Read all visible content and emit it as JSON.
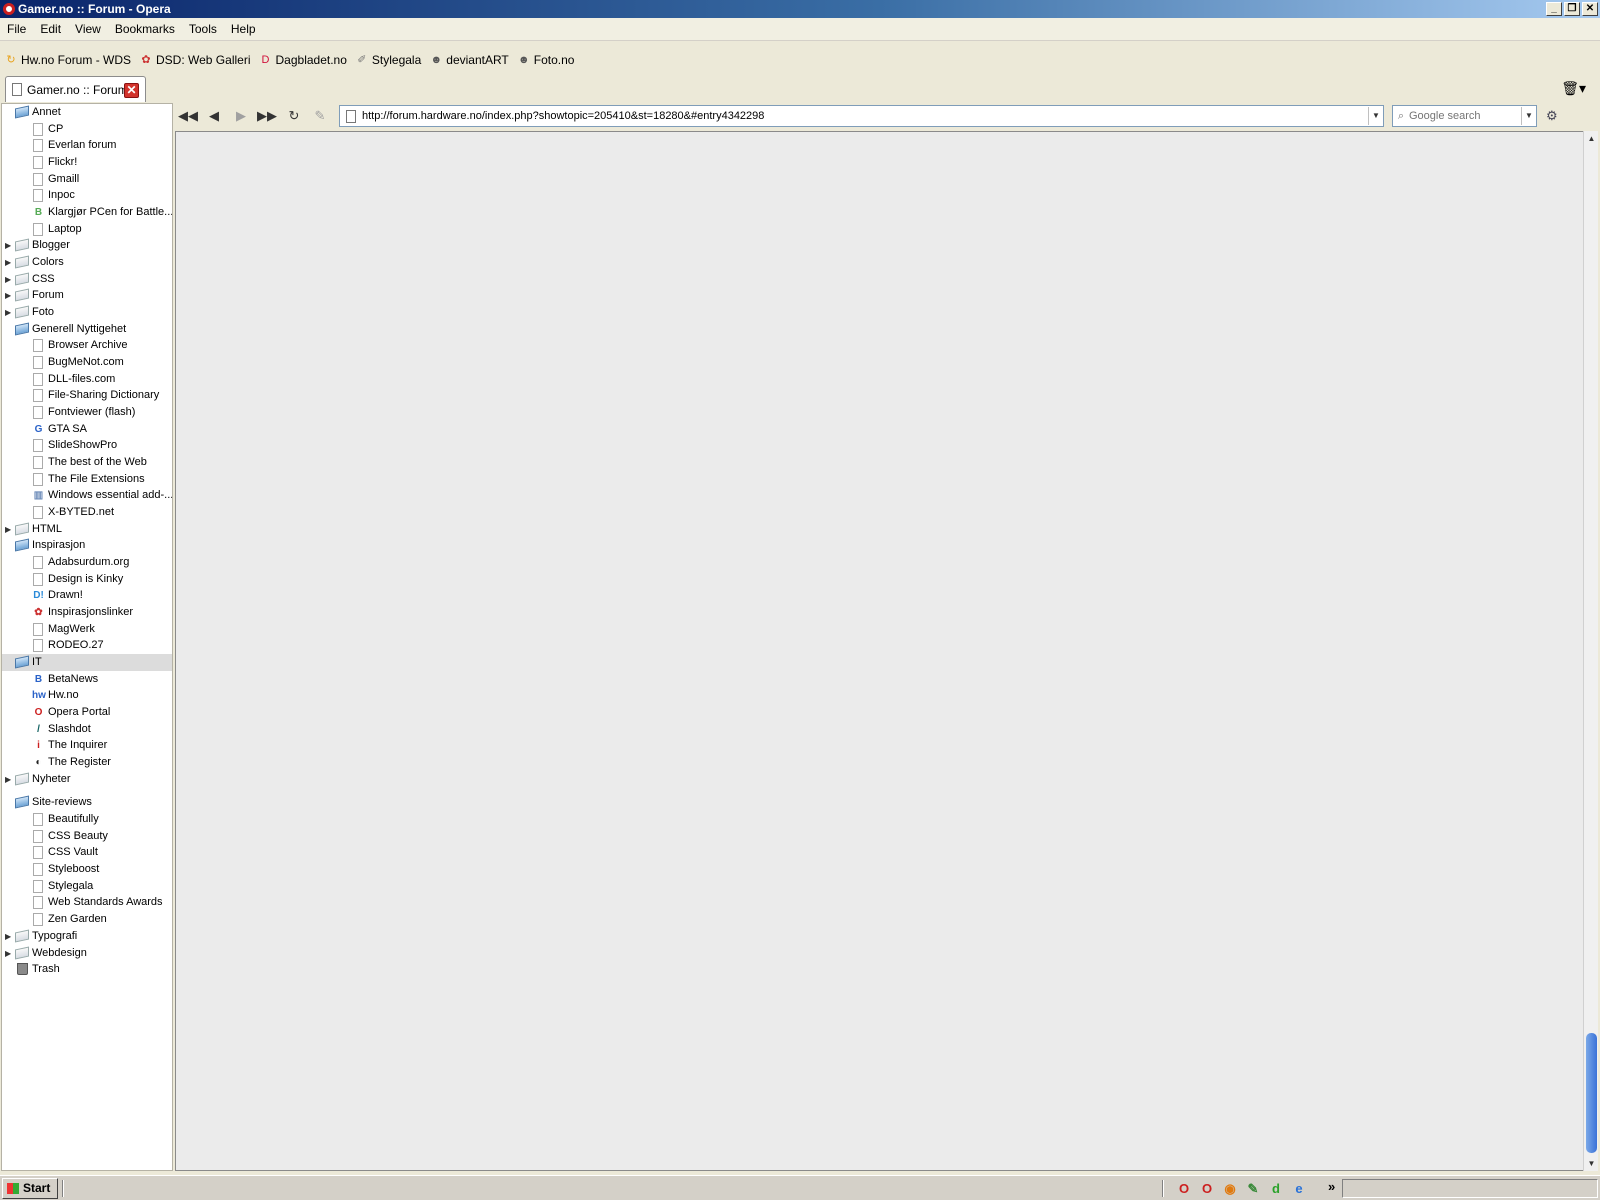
{
  "window": {
    "title": "Gamer.no :: Forum - Opera",
    "controls": [
      "_",
      "❐",
      "✕"
    ]
  },
  "menubar": [
    "File",
    "Edit",
    "View",
    "Bookmarks",
    "Tools",
    "Help"
  ],
  "personal_bar": [
    {
      "label": "Hw.no Forum - WDS",
      "icon": "hw-icon",
      "glyph": "↻",
      "color": "#e8a21c"
    },
    {
      "label": "DSD: Web Galleri",
      "icon": "dsd-icon",
      "glyph": "✿",
      "color": "#c33"
    },
    {
      "label": "Dagbladet.no",
      "icon": "dagbladet-icon",
      "glyph": "D",
      "color": "#d0103a"
    },
    {
      "label": "Stylegala",
      "icon": "stylegala-icon",
      "glyph": "✐",
      "color": "#777"
    },
    {
      "label": "deviantART",
      "icon": "deviantart-icon",
      "glyph": "☻",
      "color": "#555"
    },
    {
      "label": "Foto.no",
      "icon": "foto-icon",
      "glyph": "☻",
      "color": "#555"
    }
  ],
  "tab": {
    "label": "Gamer.no :: Forum",
    "close": "✕"
  },
  "panel": {
    "rows": [
      {
        "kind": "folder",
        "label": "Annet",
        "open": true
      },
      {
        "kind": "bm",
        "label": "CP",
        "icon": "doc"
      },
      {
        "kind": "bm",
        "label": "Everlan forum",
        "icon": "doc"
      },
      {
        "kind": "bm",
        "label": "Flickr!",
        "icon": "doc"
      },
      {
        "kind": "bm",
        "label": "Gmaill",
        "icon": "doc"
      },
      {
        "kind": "bm",
        "label": "Inpoc",
        "icon": "doc"
      },
      {
        "kind": "bm",
        "label": "Klargjør PCen for Battle...",
        "icon": "badge",
        "glyph": "B",
        "color": "#5a5"
      },
      {
        "kind": "bm",
        "label": "Laptop",
        "icon": "doc"
      },
      {
        "kind": "folder",
        "label": "Blogger",
        "open": false
      },
      {
        "kind": "folder",
        "label": "Colors",
        "open": false
      },
      {
        "kind": "folder",
        "label": "CSS",
        "open": false
      },
      {
        "kind": "folder",
        "label": "Forum",
        "open": false
      },
      {
        "kind": "folder",
        "label": "Foto",
        "open": false
      },
      {
        "kind": "folder",
        "label": "Generell Nyttigehet",
        "open": true
      },
      {
        "kind": "bm",
        "label": "Browser Archive",
        "icon": "doc"
      },
      {
        "kind": "bm",
        "label": "BugMeNot.com",
        "icon": "doc"
      },
      {
        "kind": "bm",
        "label": "DLL-files.com",
        "icon": "doc"
      },
      {
        "kind": "bm",
        "label": "File-Sharing Dictionary",
        "icon": "doc"
      },
      {
        "kind": "bm",
        "label": "Fontviewer (flash)",
        "icon": "doc"
      },
      {
        "kind": "bm",
        "label": "GTA SA",
        "icon": "badge",
        "glyph": "G",
        "color": "#2a62c8"
      },
      {
        "kind": "bm",
        "label": "SlideShowPro",
        "icon": "doc"
      },
      {
        "kind": "bm",
        "label": "The best of the Web",
        "icon": "doc"
      },
      {
        "kind": "bm",
        "label": "The File Extensions",
        "icon": "doc"
      },
      {
        "kind": "bm",
        "label": "Windows essential add-...",
        "icon": "badge",
        "glyph": "▥",
        "color": "#6a8ab8"
      },
      {
        "kind": "bm",
        "label": "X-BYTED.net",
        "icon": "doc"
      },
      {
        "kind": "folder",
        "label": "HTML",
        "open": false
      },
      {
        "kind": "folder",
        "label": "Inspirasjon",
        "open": true
      },
      {
        "kind": "bm",
        "label": "Adabsurdum.org",
        "icon": "doc"
      },
      {
        "kind": "bm",
        "label": "Design is Kinky",
        "icon": "doc"
      },
      {
        "kind": "bm",
        "label": "Drawn!",
        "icon": "badge",
        "glyph": "D!",
        "color": "#2a8ad8"
      },
      {
        "kind": "bm",
        "label": "Inspirasjonslinker",
        "icon": "badge",
        "glyph": "✿",
        "color": "#c33"
      },
      {
        "kind": "bm",
        "label": "MagWerk",
        "icon": "doc"
      },
      {
        "kind": "bm",
        "label": "RODEO.27",
        "icon": "doc"
      },
      {
        "kind": "folder",
        "label": "IT",
        "open": true,
        "selected": true
      },
      {
        "kind": "bm",
        "label": "BetaNews",
        "icon": "badge",
        "glyph": "B",
        "color": "#2a62c8"
      },
      {
        "kind": "bm",
        "label": "Hw.no",
        "icon": "badge",
        "glyph": "hw",
        "color": "#2a62c8"
      },
      {
        "kind": "bm",
        "label": "Opera Portal",
        "icon": "badge",
        "glyph": "O",
        "color": "#cc1f1f"
      },
      {
        "kind": "bm",
        "label": "Slashdot",
        "icon": "badge",
        "glyph": "/",
        "color": "#106060"
      },
      {
        "kind": "bm",
        "label": "The Inquirer",
        "icon": "badge",
        "glyph": "i",
        "color": "#cc1f1f"
      },
      {
        "kind": "bm",
        "label": "The Register",
        "icon": "badge",
        "glyph": "◐",
        "color": "#222"
      },
      {
        "kind": "folder",
        "label": "Nyheter",
        "open": false
      },
      {
        "kind": "folder",
        "label": "Site-reviews",
        "open": true,
        "gap": true
      },
      {
        "kind": "bm",
        "label": "Beautifully",
        "icon": "doc"
      },
      {
        "kind": "bm",
        "label": "CSS Beauty",
        "icon": "doc"
      },
      {
        "kind": "bm",
        "label": "CSS Vault",
        "icon": "doc"
      },
      {
        "kind": "bm",
        "label": "Styleboost",
        "icon": "doc"
      },
      {
        "kind": "bm",
        "label": "Stylegala",
        "icon": "doc"
      },
      {
        "kind": "bm",
        "label": "Web Standards Awards",
        "icon": "doc"
      },
      {
        "kind": "bm",
        "label": "Zen Garden",
        "icon": "doc"
      },
      {
        "kind": "folder",
        "label": "Typografi",
        "open": false
      },
      {
        "kind": "folder",
        "label": "Webdesign",
        "open": false
      },
      {
        "kind": "trash",
        "label": "Trash"
      }
    ]
  },
  "navbar": {
    "rewind": "◀◀",
    "back": "◀",
    "forward": "▶",
    "fast_forward": "▶▶",
    "reload": "↻",
    "edit": "✎",
    "url": "http://forum.hardware.no/index.php?showtopic=205410&st=18280&#entry4342298",
    "search_placeholder": "Google search",
    "dropdown": "▼"
  },
  "taskbar": {
    "start_label": "Start",
    "tray_chevron": "»",
    "quicklaunch": [
      {
        "name": "opera-icon",
        "glyph": "O",
        "color": "#cc1f1f"
      },
      {
        "name": "opera-icon-2",
        "glyph": "O",
        "color": "#cc1f1f"
      },
      {
        "name": "firefox-icon",
        "glyph": "◉",
        "color": "#e07a10"
      },
      {
        "name": "editor-icon",
        "glyph": "✎",
        "color": "#3a8a3a"
      },
      {
        "name": "dreamweaver-icon",
        "glyph": "d",
        "color": "#2aa22a"
      },
      {
        "name": "ie-icon",
        "glyph": "e",
        "color": "#2a72d8"
      }
    ]
  }
}
